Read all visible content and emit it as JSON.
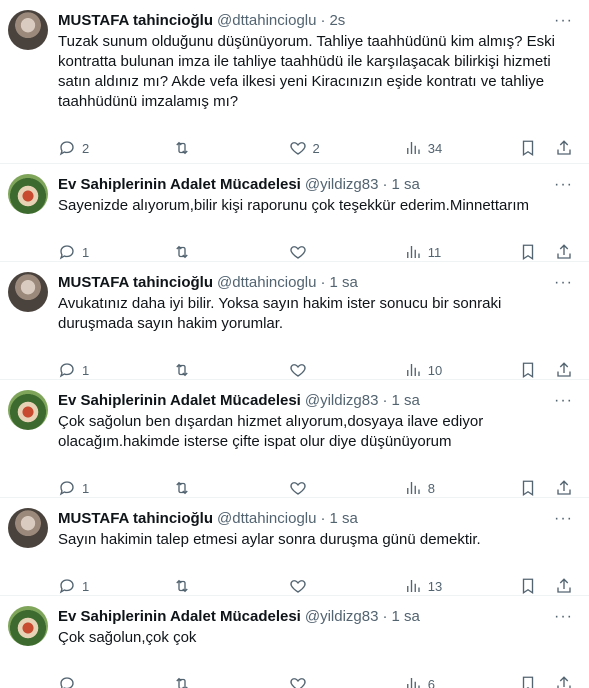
{
  "tweets": [
    {
      "name": "MUSTAFA tahincioğlu",
      "handle": "@dttahincioglu",
      "dot": "·",
      "time": "2s",
      "text": "Tuzak sunum olduğunu düşünüyorum. Tahliye taahhüdünü kim almış? Eski kontratta bulunan imza ile tahliye taahhüdü ile karşılaşacak bilirkişi hizmeti satın aldınız mı? Akde vefa ilkesi yeni Kiracınızın eşide kontratı ve tahliye taahhüdünü imzalamış mı?",
      "replies": "2",
      "retweets": "",
      "likes": "2",
      "views": "34"
    },
    {
      "name": "Ev Sahiplerinin Adalet Mücadelesi",
      "handle": "@yildizg83",
      "dot": "·",
      "time": "1 sa",
      "text": "Sayenizde alıyorum,bilir kişi raporunu çok teşekkür ederim.Minnettarım",
      "replies": "1",
      "retweets": "",
      "likes": "",
      "views": "11"
    },
    {
      "name": "MUSTAFA tahincioğlu",
      "handle": "@dttahincioglu",
      "dot": "·",
      "time": "1 sa",
      "text": "Avukatınız daha iyi bilir. Yoksa sayın hakim ister sonucu bir sonraki duruşmada sayın hakim yorumlar.",
      "replies": "1",
      "retweets": "",
      "likes": "",
      "views": "10"
    },
    {
      "name": "Ev Sahiplerinin Adalet Mücadelesi",
      "handle": "@yildizg83",
      "dot": "·",
      "time": "1 sa",
      "text": "Çok sağolun ben dışardan hizmet alıyorum,dosyaya ilave ediyor olacağım.hakimde isterse çifte ispat olur diye düşünüyorum",
      "replies": "1",
      "retweets": "",
      "likes": "",
      "views": "8"
    },
    {
      "name": "MUSTAFA tahincioğlu",
      "handle": "@dttahincioglu",
      "dot": "·",
      "time": "1 sa",
      "text": "Sayın hakimin talep etmesi aylar sonra duruşma günü demektir.",
      "replies": "1",
      "retweets": "",
      "likes": "",
      "views": "13"
    },
    {
      "name": "Ev Sahiplerinin Adalet Mücadelesi",
      "handle": "@yildizg83",
      "dot": "·",
      "time": "1 sa",
      "text": "Çok sağolun,çok çok",
      "replies": "",
      "retweets": "",
      "likes": "",
      "views": "6"
    }
  ],
  "icons": {
    "more": "more-horizontal-icon",
    "reply": "reply-icon",
    "retweet": "retweet-icon",
    "like": "heart-icon",
    "views": "views-icon",
    "bookmark": "bookmark-icon",
    "share": "share-icon"
  }
}
